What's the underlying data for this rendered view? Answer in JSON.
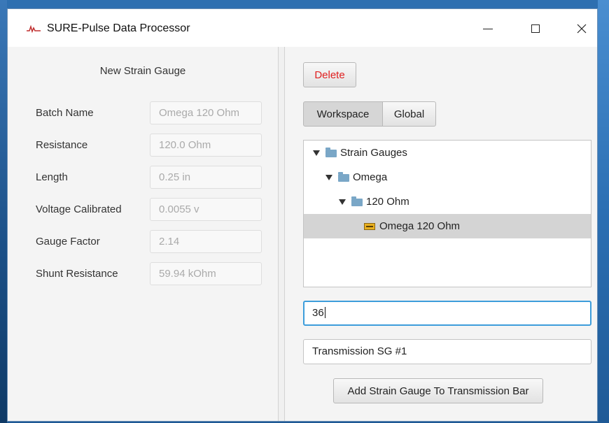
{
  "window": {
    "title": "SURE-Pulse Data Processor",
    "icon": "sure-pulse-logo-icon",
    "controls": [
      "minimize",
      "maximize",
      "close"
    ]
  },
  "left_panel": {
    "heading": "New Strain Gauge",
    "fields": [
      {
        "label": "Batch Name",
        "value": "Omega 120 Ohm"
      },
      {
        "label": "Resistance",
        "value": "120.0 Ohm"
      },
      {
        "label": "Length",
        "value": "0.25 in"
      },
      {
        "label": "Voltage Calibrated",
        "value": "0.0055 v"
      },
      {
        "label": "Gauge Factor",
        "value": "2.14"
      },
      {
        "label": "Shunt Resistance",
        "value": "59.94 kOhm"
      }
    ]
  },
  "right_panel": {
    "delete_label": "Delete",
    "toggle": {
      "workspace": "Workspace",
      "global": "Global",
      "selected": "Workspace"
    },
    "tree": [
      {
        "label": "Strain Gauges",
        "icon": "folder-icon",
        "expanded": true
      },
      {
        "label": "Omega",
        "icon": "folder-icon",
        "expanded": true
      },
      {
        "label": "120 Ohm",
        "icon": "folder-icon",
        "expanded": true
      },
      {
        "label": "Omega 120 Ohm",
        "icon": "strain-gauge-icon",
        "selected": true
      }
    ],
    "distance_input": {
      "value": "36"
    },
    "name_input": {
      "value": "Transmission SG #1"
    },
    "add_button_label": "Add Strain Gauge To Transmission Bar"
  },
  "colors": {
    "delete_text": "#e02020",
    "focus_border": "#3d9ddb",
    "selection": "#d4d4d4",
    "folder": "#7aa7c7"
  }
}
